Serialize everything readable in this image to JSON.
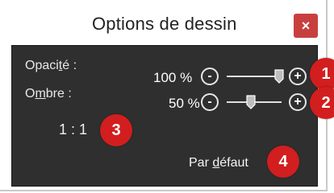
{
  "window": {
    "title": "Options de dessin",
    "close_label": "×"
  },
  "opacity": {
    "label_before": "Opaci",
    "label_underlined": "t",
    "label_after": "é :",
    "value_text": "100 %",
    "slider_value": 1.0,
    "minus_label": "-",
    "plus_label": "+"
  },
  "shadow": {
    "label_before": "O",
    "label_underlined": "m",
    "label_after": "bre :",
    "value_text": "50 %",
    "slider_value": 0.5,
    "minus_label": "-",
    "plus_label": "+"
  },
  "ratio_text": "1 : 1",
  "default_button": {
    "label_before": "Par ",
    "label_underlined": "d",
    "label_after": "éfaut"
  },
  "badges": [
    "1",
    "2",
    "3",
    "4"
  ],
  "colors": {
    "panel": "#2f2f2f",
    "badge": "#d21e1e",
    "close": "#c8403e"
  }
}
